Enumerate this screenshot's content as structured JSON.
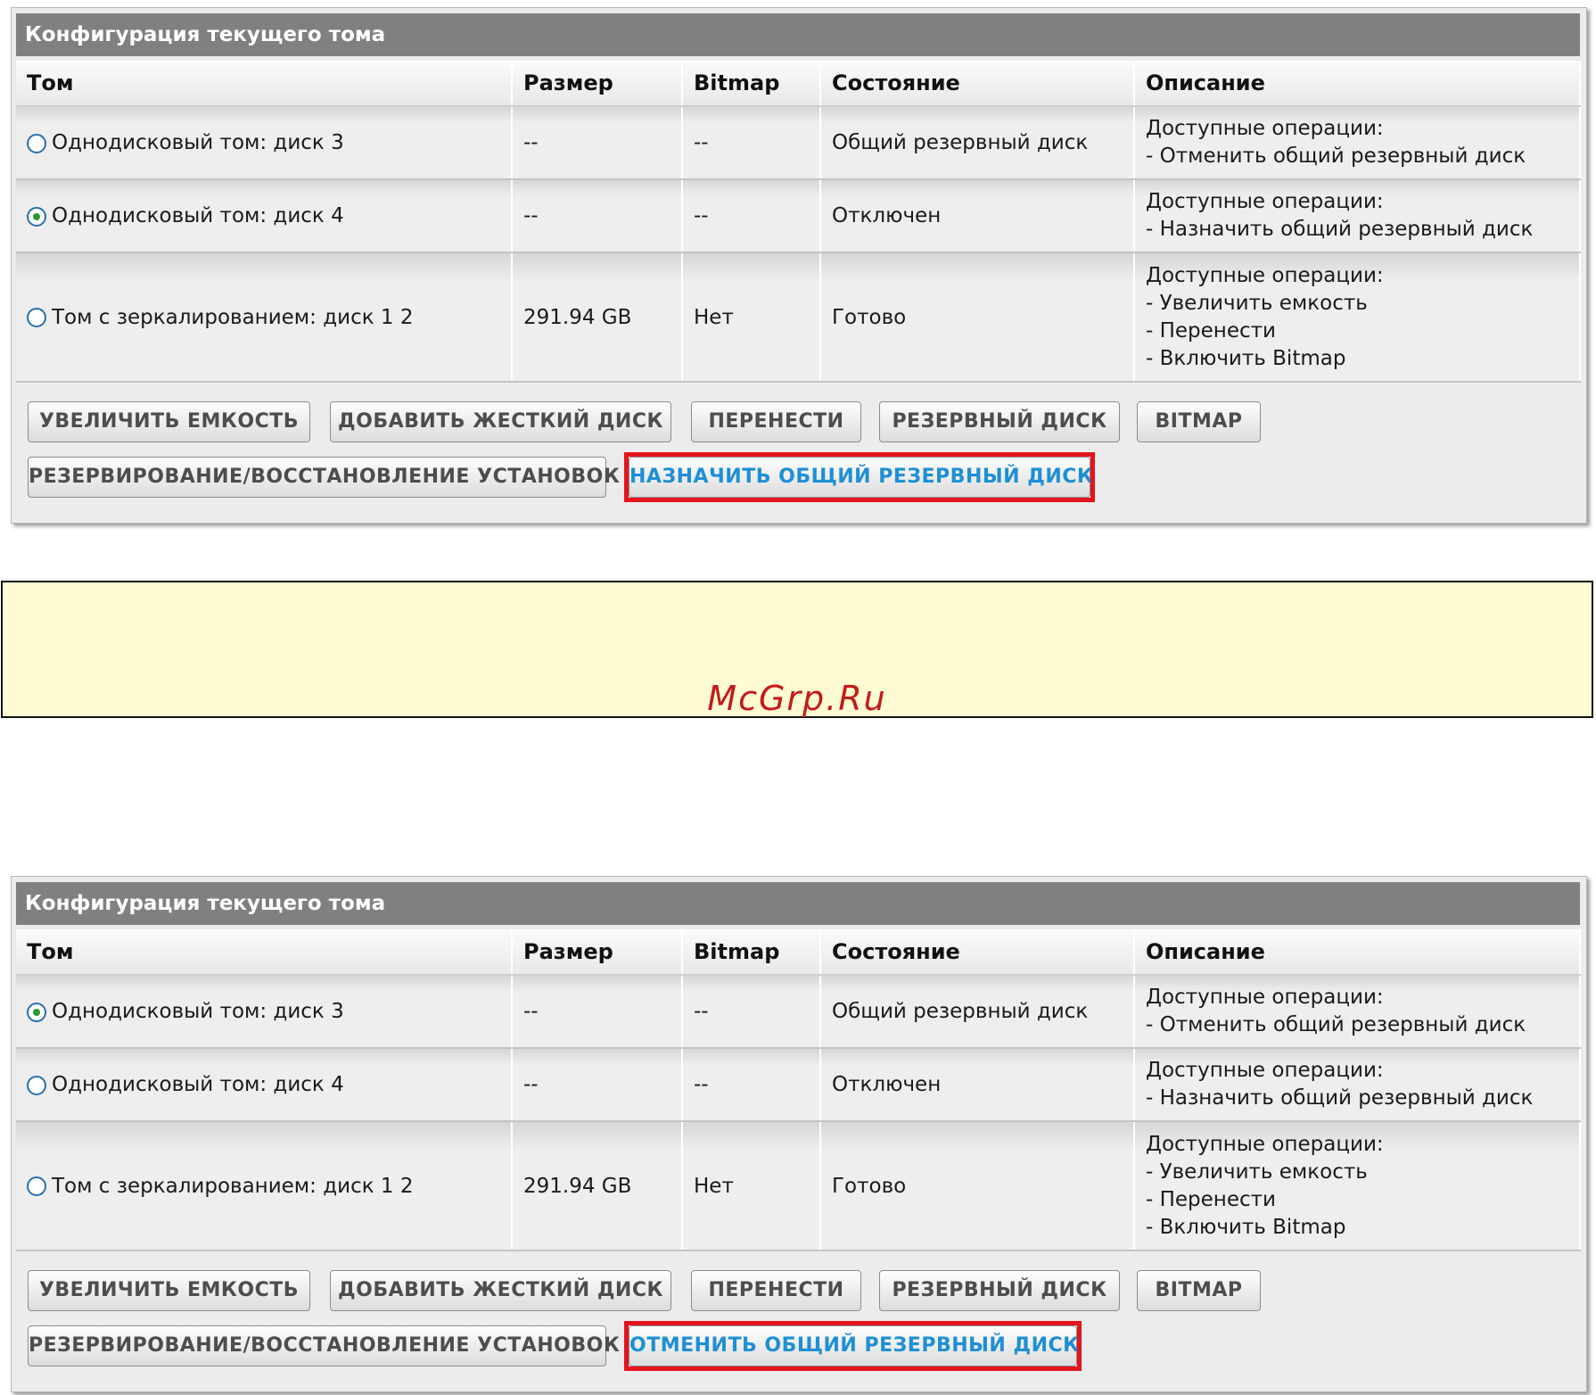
{
  "panels": [
    {
      "title": "Конфигурация текущего тома",
      "columns": [
        "Том",
        "Размер",
        "Bitmap",
        "Состояние",
        "Описание"
      ],
      "rows": [
        {
          "selected": false,
          "volume": "Однодисковый том: диск 3",
          "size": "--",
          "bitmap": "--",
          "status": "Общий резервный диск",
          "desc": [
            "Доступные операции:",
            " - Отменить общий резервный диск"
          ]
        },
        {
          "selected": true,
          "volume": "Однодисковый том: диск 4",
          "size": "--",
          "bitmap": "--",
          "status": "Отключен",
          "desc": [
            "Доступные операции:",
            " - Назначить общий резервный диск"
          ]
        },
        {
          "selected": false,
          "volume": "Том с зеркалированием: диск 1 2",
          "size": "291.94 GB",
          "bitmap": "Нет",
          "status": "Готово",
          "desc": [
            "Доступные операции:",
            " - Увеличить емкость",
            " - Перенести",
            " - Включить Bitmap"
          ]
        }
      ],
      "buttons": {
        "expand": "УВЕЛИЧИТЬ ЕМКОСТЬ",
        "add_disk": "ДОБАВИТЬ ЖЕСТКИЙ ДИСК",
        "migrate": "ПЕРЕНЕСТИ",
        "spare": "РЕЗЕРВНЫЙ ДИСК",
        "bitmap": "BITMAP",
        "backup_restore": "РЕЗЕРВИРОВАНИЕ/ВОССТАНОВЛЕНИЕ УСТАНОВОК",
        "highlighted": "НАЗНАЧИТЬ ОБЩИЙ РЕЗЕРВНЫЙ ДИСК"
      }
    },
    {
      "title": "Конфигурация текущего тома",
      "columns": [
        "Том",
        "Размер",
        "Bitmap",
        "Состояние",
        "Описание"
      ],
      "rows": [
        {
          "selected": true,
          "volume": "Однодисковый том: диск 3",
          "size": "--",
          "bitmap": "--",
          "status": "Общий резервный диск",
          "desc": [
            "Доступные операции:",
            " - Отменить общий резервный диск"
          ]
        },
        {
          "selected": false,
          "volume": "Однодисковый том: диск 4",
          "size": "--",
          "bitmap": "--",
          "status": "Отключен",
          "desc": [
            "Доступные операции:",
            " - Назначить общий резервный диск"
          ]
        },
        {
          "selected": false,
          "volume": "Том с зеркалированием: диск 1 2",
          "size": "291.94 GB",
          "bitmap": "Нет",
          "status": "Готово",
          "desc": [
            "Доступные операции:",
            " - Увеличить емкость",
            " - Перенести",
            " - Включить Bitmap"
          ]
        }
      ],
      "buttons": {
        "expand": "УВЕЛИЧИТЬ ЕМКОСТЬ",
        "add_disk": "ДОБАВИТЬ ЖЕСТКИЙ ДИСК",
        "migrate": "ПЕРЕНЕСТИ",
        "spare": "РЕЗЕРВНЫЙ ДИСК",
        "bitmap": "BITMAP",
        "backup_restore": "РЕЗЕРВИРОВАНИЕ/ВОССТАНОВЛЕНИЕ УСТАНОВОК",
        "highlighted": "ОТМЕНИТЬ ОБЩИЙ РЕЗЕРВНЫЙ ДИСК"
      }
    }
  ],
  "banner": {
    "text": "McGrp.Ru"
  },
  "colors": {
    "title_bar": "#808080",
    "highlight_border": "#e3141c",
    "accent_text": "#1e8fd4",
    "banner_bg": "#fffbd2",
    "banner_text": "#c41a1a"
  }
}
